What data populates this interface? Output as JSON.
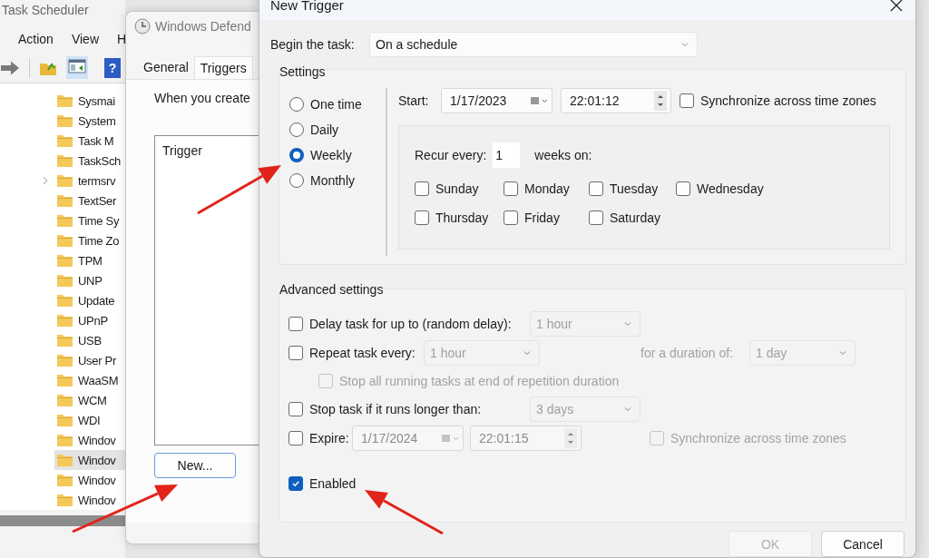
{
  "task_scheduler": {
    "title": "Task Scheduler",
    "menu": [
      "Action",
      "View",
      "H"
    ],
    "help_glyph": "?",
    "tree_items": [
      {
        "label": "Sysmai",
        "selected": false,
        "expandable": false
      },
      {
        "label": "System",
        "selected": false,
        "expandable": false
      },
      {
        "label": "Task M",
        "selected": false,
        "expandable": false
      },
      {
        "label": "TaskSch",
        "selected": false,
        "expandable": false
      },
      {
        "label": "termsrv",
        "selected": false,
        "expandable": true
      },
      {
        "label": "TextSer",
        "selected": false,
        "expandable": false
      },
      {
        "label": "Time Sy",
        "selected": false,
        "expandable": false
      },
      {
        "label": "Time Zo",
        "selected": false,
        "expandable": false
      },
      {
        "label": "TPM",
        "selected": false,
        "expandable": false
      },
      {
        "label": "UNP",
        "selected": false,
        "expandable": false
      },
      {
        "label": "Update",
        "selected": false,
        "expandable": false
      },
      {
        "label": "UPnP",
        "selected": false,
        "expandable": false
      },
      {
        "label": "USB",
        "selected": false,
        "expandable": false
      },
      {
        "label": "User Pr",
        "selected": false,
        "expandable": false
      },
      {
        "label": "WaaSM",
        "selected": false,
        "expandable": false
      },
      {
        "label": "WCM",
        "selected": false,
        "expandable": false
      },
      {
        "label": "WDI",
        "selected": false,
        "expandable": false
      },
      {
        "label": "Windov",
        "selected": false,
        "expandable": false
      },
      {
        "label": "Windov",
        "selected": true,
        "expandable": false
      },
      {
        "label": "Windov",
        "selected": false,
        "expandable": false
      },
      {
        "label": "Windov",
        "selected": false,
        "expandable": false
      }
    ]
  },
  "properties_dialog": {
    "title": "Windows Defend",
    "tabs": [
      {
        "label": "General",
        "selected": false
      },
      {
        "label": "Triggers",
        "selected": true
      }
    ],
    "description": "When you create",
    "list_header": "Trigger",
    "new_button": "New..."
  },
  "new_trigger": {
    "title": "New Trigger",
    "begin_label": "Begin the task:",
    "begin_value": "On a schedule",
    "settings_label": "Settings",
    "schedule_options": [
      {
        "label": "One time",
        "selected": false
      },
      {
        "label": "Daily",
        "selected": false
      },
      {
        "label": "Weekly",
        "selected": true
      },
      {
        "label": "Monthly",
        "selected": false
      }
    ],
    "start_label": "Start:",
    "start_date": "1/17/2023",
    "start_time": "22:01:12",
    "sync": {
      "label": "Synchronize across time zones",
      "checked": false
    },
    "recur_label": "Recur every:",
    "recur_value": "1",
    "recur_unit": "weeks on:",
    "days": [
      {
        "label": "Sunday",
        "checked": false
      },
      {
        "label": "Monday",
        "checked": false
      },
      {
        "label": "Tuesday",
        "checked": false
      },
      {
        "label": "Wednesday",
        "checked": false
      },
      {
        "label": "Thursday",
        "checked": false
      },
      {
        "label": "Friday",
        "checked": false
      },
      {
        "label": "Saturday",
        "checked": false
      }
    ],
    "advanced_label": "Advanced settings",
    "delay": {
      "label": "Delay task for up to (random delay):",
      "checked": false,
      "value": "1 hour",
      "disabled": true
    },
    "repeat": {
      "label": "Repeat task every:",
      "checked": false,
      "value": "1 hour",
      "disabled": true,
      "duration_label": "for a duration of:",
      "duration_value": "1 day"
    },
    "stop_all": {
      "label": "Stop all running tasks at end of repetition duration",
      "checked": false,
      "disabled": true
    },
    "stop_task": {
      "label": "Stop task if it runs longer than:",
      "checked": false,
      "value": "3 days",
      "disabled": true
    },
    "expire": {
      "label": "Expire:",
      "checked": false,
      "date": "1/17/2024",
      "time": "22:01:15",
      "disabled": true,
      "sync_label": "Synchronize across time zones",
      "sync_checked": false
    },
    "enabled": {
      "label": "Enabled",
      "checked": true
    },
    "buttons": [
      {
        "label": "OK",
        "disabled": true
      },
      {
        "label": "Cancel",
        "disabled": false
      }
    ]
  }
}
